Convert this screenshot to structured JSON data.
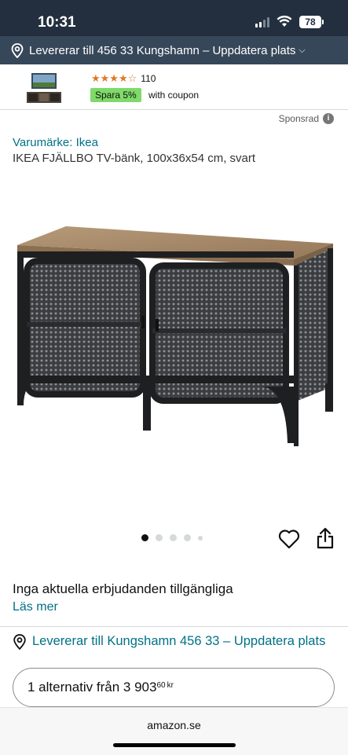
{
  "status_bar": {
    "time": "10:31",
    "battery": "78"
  },
  "location_bar": {
    "text": "Levererar till 456 33 Kungshamn – Uppdatera plats"
  },
  "ad": {
    "rating_count": "110",
    "save_badge": "Spara 5%",
    "coupon_text": "with coupon",
    "rating_value": 4.5
  },
  "sponsored": {
    "label": "Sponsrad",
    "info_icon": "info-icon"
  },
  "product": {
    "brand": "Varumärke: Ikea",
    "title": "IKEA FJÄLLBO TV-bänk, 100x36x54 cm, svart",
    "image_count": 5,
    "active_image": 1
  },
  "offers": {
    "text": "Inga aktuella erbjudanden tillgängliga",
    "read_more": "Läs mer"
  },
  "delivery": {
    "text": "Levererar till Kungshamn 456 33 – Uppdatera plats"
  },
  "alternatives": {
    "prefix": "1 alternativ från 3 903",
    "cents": "60",
    "currency": "kr"
  },
  "browser": {
    "domain": "amazon.se"
  },
  "colors": {
    "header": "#232f3e",
    "location": "#37475a",
    "link": "#007185",
    "star": "#de7921",
    "badge": "#7fda69"
  }
}
